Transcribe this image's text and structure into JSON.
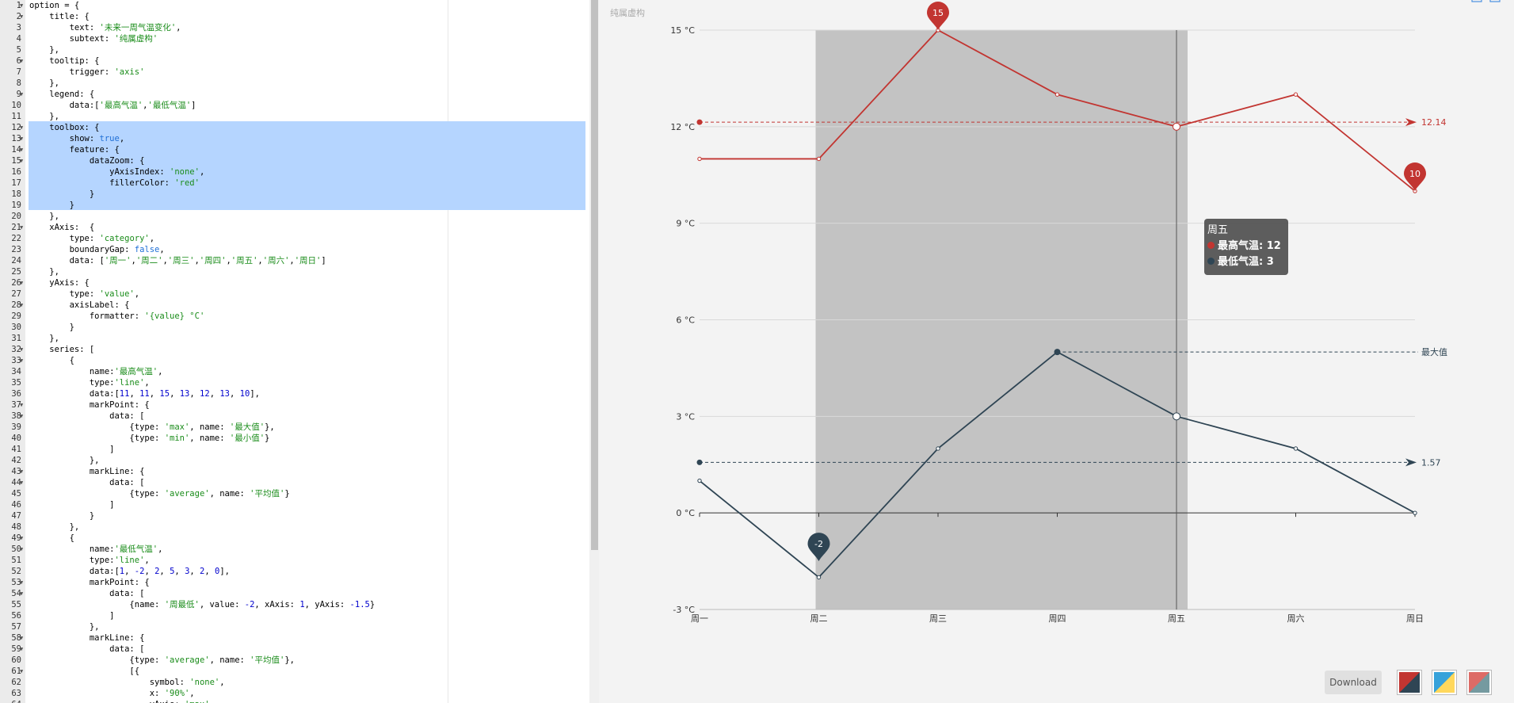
{
  "editor": {
    "lines": [
      [
        [
          "t",
          "option = {"
        ]
      ],
      [
        [
          "t",
          "    title: {"
        ]
      ],
      [
        [
          "t",
          "        text: "
        ],
        [
          "s",
          "'未来一周气温变化'"
        ],
        [
          "t",
          ","
        ]
      ],
      [
        [
          "t",
          "        subtext: "
        ],
        [
          "s",
          "'纯属虚构'"
        ]
      ],
      [
        [
          "t",
          "    },"
        ]
      ],
      [
        [
          "t",
          "    tooltip: {"
        ]
      ],
      [
        [
          "t",
          "        trigger: "
        ],
        [
          "s",
          "'axis'"
        ]
      ],
      [
        [
          "t",
          "    },"
        ]
      ],
      [
        [
          "t",
          "    legend: {"
        ]
      ],
      [
        [
          "t",
          "        data:["
        ],
        [
          "s",
          "'最高气温'"
        ],
        [
          "t",
          ","
        ],
        [
          "s",
          "'最低气温'"
        ],
        [
          "t",
          "]"
        ]
      ],
      [
        [
          "t",
          "    },"
        ]
      ],
      [
        [
          "t",
          "    toolbox: {"
        ]
      ],
      [
        [
          "t",
          "        show: "
        ],
        [
          "k",
          "true"
        ],
        [
          "t",
          ","
        ]
      ],
      [
        [
          "t",
          "        feature: {"
        ]
      ],
      [
        [
          "t",
          "            dataZoom: {"
        ]
      ],
      [
        [
          "t",
          "                yAxisIndex: "
        ],
        [
          "s",
          "'none'"
        ],
        [
          "t",
          ","
        ]
      ],
      [
        [
          "t",
          "                fillerColor: "
        ],
        [
          "s",
          "'red'"
        ]
      ],
      [
        [
          "t",
          "            }"
        ]
      ],
      [
        [
          "t",
          "        }"
        ]
      ],
      [
        [
          "t",
          "    },"
        ]
      ],
      [
        [
          "t",
          "    xAxis:  {"
        ]
      ],
      [
        [
          "t",
          "        type: "
        ],
        [
          "s",
          "'category'"
        ],
        [
          "t",
          ","
        ]
      ],
      [
        [
          "t",
          "        boundaryGap: "
        ],
        [
          "k",
          "false"
        ],
        [
          "t",
          ","
        ]
      ],
      [
        [
          "t",
          "        data: ["
        ],
        [
          "s",
          "'周一'"
        ],
        [
          "t",
          ","
        ],
        [
          "s",
          "'周二'"
        ],
        [
          "t",
          ","
        ],
        [
          "s",
          "'周三'"
        ],
        [
          "t",
          ","
        ],
        [
          "s",
          "'周四'"
        ],
        [
          "t",
          ","
        ],
        [
          "s",
          "'周五'"
        ],
        [
          "t",
          ","
        ],
        [
          "s",
          "'周六'"
        ],
        [
          "t",
          ","
        ],
        [
          "s",
          "'周日'"
        ],
        [
          "t",
          "]"
        ]
      ],
      [
        [
          "t",
          "    },"
        ]
      ],
      [
        [
          "t",
          "    yAxis: {"
        ]
      ],
      [
        [
          "t",
          "        type: "
        ],
        [
          "s",
          "'value'"
        ],
        [
          "t",
          ","
        ]
      ],
      [
        [
          "t",
          "        axisLabel: {"
        ]
      ],
      [
        [
          "t",
          "            formatter: "
        ],
        [
          "s",
          "'{value} °C'"
        ]
      ],
      [
        [
          "t",
          "        }"
        ]
      ],
      [
        [
          "t",
          "    },"
        ]
      ],
      [
        [
          "t",
          "    series: ["
        ]
      ],
      [
        [
          "t",
          "        {"
        ]
      ],
      [
        [
          "t",
          "            name:"
        ],
        [
          "s",
          "'最高气温'"
        ],
        [
          "t",
          ","
        ]
      ],
      [
        [
          "t",
          "            type:"
        ],
        [
          "s",
          "'line'"
        ],
        [
          "t",
          ","
        ]
      ],
      [
        [
          "t",
          "            data:["
        ],
        [
          "n",
          "11"
        ],
        [
          "t",
          ", "
        ],
        [
          "n",
          "11"
        ],
        [
          "t",
          ", "
        ],
        [
          "n",
          "15"
        ],
        [
          "t",
          ", "
        ],
        [
          "n",
          "13"
        ],
        [
          "t",
          ", "
        ],
        [
          "n",
          "12"
        ],
        [
          "t",
          ", "
        ],
        [
          "n",
          "13"
        ],
        [
          "t",
          ", "
        ],
        [
          "n",
          "10"
        ],
        [
          "t",
          "],"
        ]
      ],
      [
        [
          "t",
          "            markPoint: {"
        ]
      ],
      [
        [
          "t",
          "                data: ["
        ]
      ],
      [
        [
          "t",
          "                    {type: "
        ],
        [
          "s",
          "'max'"
        ],
        [
          "t",
          ", name: "
        ],
        [
          "s",
          "'最大值'"
        ],
        [
          "t",
          "},"
        ]
      ],
      [
        [
          "t",
          "                    {type: "
        ],
        [
          "s",
          "'min'"
        ],
        [
          "t",
          ", name: "
        ],
        [
          "s",
          "'最小值'"
        ],
        [
          "t",
          "}"
        ]
      ],
      [
        [
          "t",
          "                ]"
        ]
      ],
      [
        [
          "t",
          "            },"
        ]
      ],
      [
        [
          "t",
          "            markLine: {"
        ]
      ],
      [
        [
          "t",
          "                data: ["
        ]
      ],
      [
        [
          "t",
          "                    {type: "
        ],
        [
          "s",
          "'average'"
        ],
        [
          "t",
          ", name: "
        ],
        [
          "s",
          "'平均值'"
        ],
        [
          "t",
          "}"
        ]
      ],
      [
        [
          "t",
          "                ]"
        ]
      ],
      [
        [
          "t",
          "            }"
        ]
      ],
      [
        [
          "t",
          "        },"
        ]
      ],
      [
        [
          "t",
          "        {"
        ]
      ],
      [
        [
          "t",
          "            name:"
        ],
        [
          "s",
          "'最低气温'"
        ],
        [
          "t",
          ","
        ]
      ],
      [
        [
          "t",
          "            type:"
        ],
        [
          "s",
          "'line'"
        ],
        [
          "t",
          ","
        ]
      ],
      [
        [
          "t",
          "            data:["
        ],
        [
          "n",
          "1"
        ],
        [
          "t",
          ", "
        ],
        [
          "n",
          "-2"
        ],
        [
          "t",
          ", "
        ],
        [
          "n",
          "2"
        ],
        [
          "t",
          ", "
        ],
        [
          "n",
          "5"
        ],
        [
          "t",
          ", "
        ],
        [
          "n",
          "3"
        ],
        [
          "t",
          ", "
        ],
        [
          "n",
          "2"
        ],
        [
          "t",
          ", "
        ],
        [
          "n",
          "0"
        ],
        [
          "t",
          "],"
        ]
      ],
      [
        [
          "t",
          "            markPoint: {"
        ]
      ],
      [
        [
          "t",
          "                data: ["
        ]
      ],
      [
        [
          "t",
          "                    {name: "
        ],
        [
          "s",
          "'周最低'"
        ],
        [
          "t",
          ", value: "
        ],
        [
          "n",
          "-2"
        ],
        [
          "t",
          ", xAxis: "
        ],
        [
          "n",
          "1"
        ],
        [
          "t",
          ", yAxis: "
        ],
        [
          "n",
          "-1.5"
        ],
        [
          "t",
          "}"
        ]
      ],
      [
        [
          "t",
          "                ]"
        ]
      ],
      [
        [
          "t",
          "            },"
        ]
      ],
      [
        [
          "t",
          "            markLine: {"
        ]
      ],
      [
        [
          "t",
          "                data: ["
        ]
      ],
      [
        [
          "t",
          "                    {type: "
        ],
        [
          "s",
          "'average'"
        ],
        [
          "t",
          ", name: "
        ],
        [
          "s",
          "'平均值'"
        ],
        [
          "t",
          "},"
        ]
      ],
      [
        [
          "t",
          "                    [{"
        ]
      ],
      [
        [
          "t",
          "                        symbol: "
        ],
        [
          "s",
          "'none'"
        ],
        [
          "t",
          ","
        ]
      ],
      [
        [
          "t",
          "                        x: "
        ],
        [
          "s",
          "'90%'"
        ],
        [
          "t",
          ","
        ]
      ],
      [
        [
          "t",
          "                        yAxis: "
        ],
        [
          "s",
          "'max'"
        ]
      ]
    ],
    "folded_lines": [
      1,
      2,
      6,
      9,
      12,
      13,
      14,
      15,
      21,
      26,
      28,
      32,
      33,
      37,
      38,
      43,
      44,
      49,
      50,
      53,
      54,
      58,
      59,
      61
    ]
  },
  "chart_data": {
    "type": "line",
    "subtitle": "纯属虚构",
    "categories": [
      "周一",
      "周二",
      "周三",
      "周四",
      "周五",
      "周六",
      "周日"
    ],
    "ylim": [
      -3,
      15
    ],
    "y_ticks": [
      -3,
      0,
      3,
      6,
      9,
      12,
      15
    ],
    "y_tick_format": "{value} °C",
    "zoom_range_categories": [
      "周二",
      "周五"
    ],
    "hover_category": "周五",
    "series": [
      {
        "name": "最高气温",
        "values": [
          11,
          11,
          15,
          13,
          12,
          13,
          10
        ],
        "color": "#c23531",
        "mark_points": [
          {
            "category": "周三",
            "value": 15,
            "label": "15"
          },
          {
            "category": "周日",
            "value": 10,
            "label": "10"
          }
        ],
        "mark_lines": [
          {
            "value": 12.14,
            "label": "12.14"
          }
        ]
      },
      {
        "name": "最低气温",
        "values": [
          1,
          -2,
          2,
          5,
          3,
          2,
          0
        ],
        "color": "#2f4554",
        "mark_points": [
          {
            "category": "周二",
            "value": -2,
            "label": "-2"
          }
        ],
        "mark_lines": [
          {
            "value": 1.57,
            "label": "1.57"
          },
          {
            "from_category": "周四",
            "value": 5,
            "label": "最大值"
          }
        ]
      }
    ],
    "tooltip": {
      "title": "周五",
      "rows": [
        {
          "series": "最高气温",
          "text": "最高气温: 12",
          "color": "#c23531"
        },
        {
          "series": "最低气温",
          "text": "最低气温: 3",
          "color": "#2f4554"
        }
      ]
    }
  },
  "controls": {
    "download_label": "Download",
    "themes": [
      {
        "name": "theme-default-swatch",
        "colors": [
          "#c23531",
          "#2f4554"
        ]
      },
      {
        "name": "theme-light-swatch",
        "colors": [
          "#37a2da",
          "#ffd85c"
        ]
      },
      {
        "name": "theme-dark-swatch",
        "colors": [
          "#dd6b66",
          "#759aa0"
        ]
      }
    ]
  }
}
